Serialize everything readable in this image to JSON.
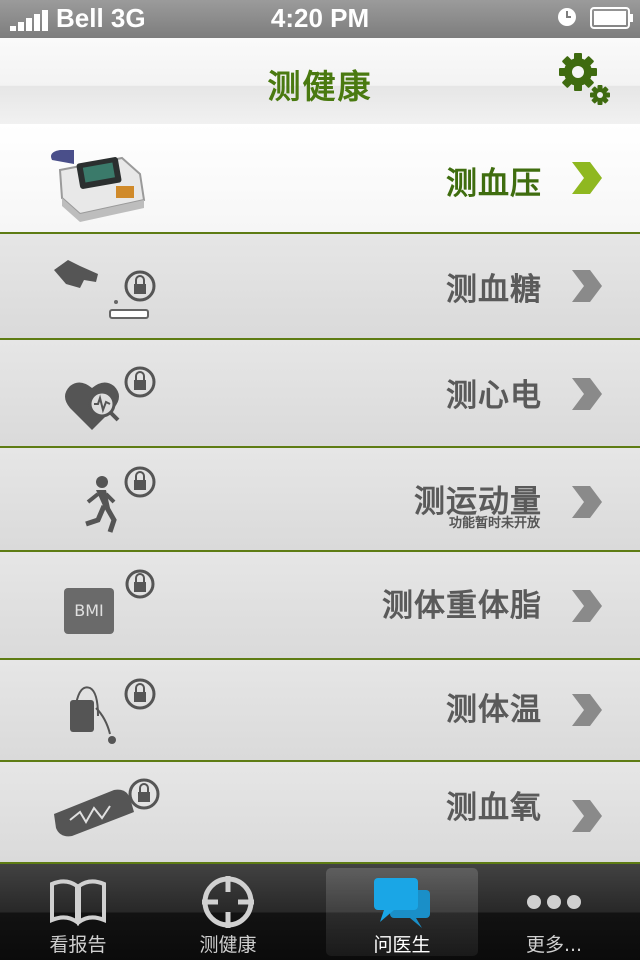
{
  "status_bar": {
    "carrier": "Bell 3G",
    "time": "4:20 PM"
  },
  "header": {
    "title": "测健康"
  },
  "menu": {
    "items": [
      {
        "label": "测血压",
        "icon": "blood-pressure-monitor-icon",
        "active": true,
        "locked": false
      },
      {
        "label": "测血糖",
        "icon": "glucose-meter-icon",
        "locked": true
      },
      {
        "label": "测心电",
        "icon": "ecg-heart-icon",
        "locked": true
      },
      {
        "label": "测运动量",
        "sublabel": "功能暂时未开放",
        "icon": "runner-icon",
        "locked": true
      },
      {
        "label": "测体重体脂",
        "icon": "bmi-scale-icon",
        "bmi_text": "BMI",
        "locked": true
      },
      {
        "label": "测体温",
        "icon": "thermometer-icon",
        "locked": true
      },
      {
        "label": "测血氧",
        "icon": "pulse-oximeter-icon",
        "locked": true
      }
    ]
  },
  "tab_bar": {
    "tabs": [
      {
        "label": "看报告",
        "icon": "book-icon"
      },
      {
        "label": "测健康",
        "icon": "crosshair-icon"
      },
      {
        "label": "问医生",
        "icon": "chat-bubbles-icon",
        "selected": true
      },
      {
        "label": "更多...",
        "icon": "more-dots-icon"
      }
    ]
  },
  "colors": {
    "accent_green": "#4a7a10",
    "separator_green": "#5e7c14",
    "chat_blue": "#1aa6e6"
  }
}
